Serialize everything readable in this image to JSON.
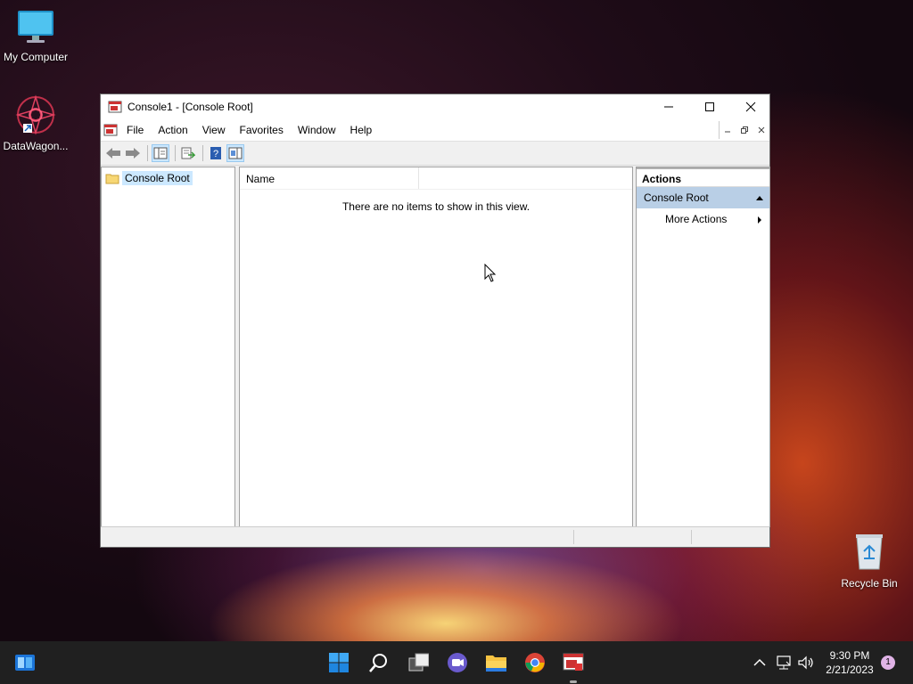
{
  "desktop": {
    "icons": [
      {
        "label": "My Computer"
      },
      {
        "label": "DataWagon..."
      },
      {
        "label": "Recycle Bin"
      }
    ]
  },
  "window": {
    "title": "Console1 - [Console Root]",
    "menu": [
      "File",
      "Action",
      "View",
      "Favorites",
      "Window",
      "Help"
    ],
    "toolbar_icons": [
      "back-arrow-icon",
      "forward-arrow-icon",
      "show-hide-tree-icon",
      "export-list-icon",
      "help-icon",
      "show-hide-action-pane-icon"
    ]
  },
  "tree": {
    "root": "Console Root"
  },
  "result_pane": {
    "column_name": "Name",
    "empty_message": "There are no items to show in this view."
  },
  "actions_pane": {
    "header": "Actions",
    "section": "Console Root",
    "more_actions": "More Actions"
  },
  "taskbar": {
    "time": "9:30 PM",
    "date": "2/21/2023",
    "notification_count": "1"
  },
  "colors": {
    "accent_selection": "#cce8ff",
    "actions_section_bg": "#b9cfe6",
    "taskbar_bg": "#202020",
    "notification_badge": "#e0b3e6"
  }
}
